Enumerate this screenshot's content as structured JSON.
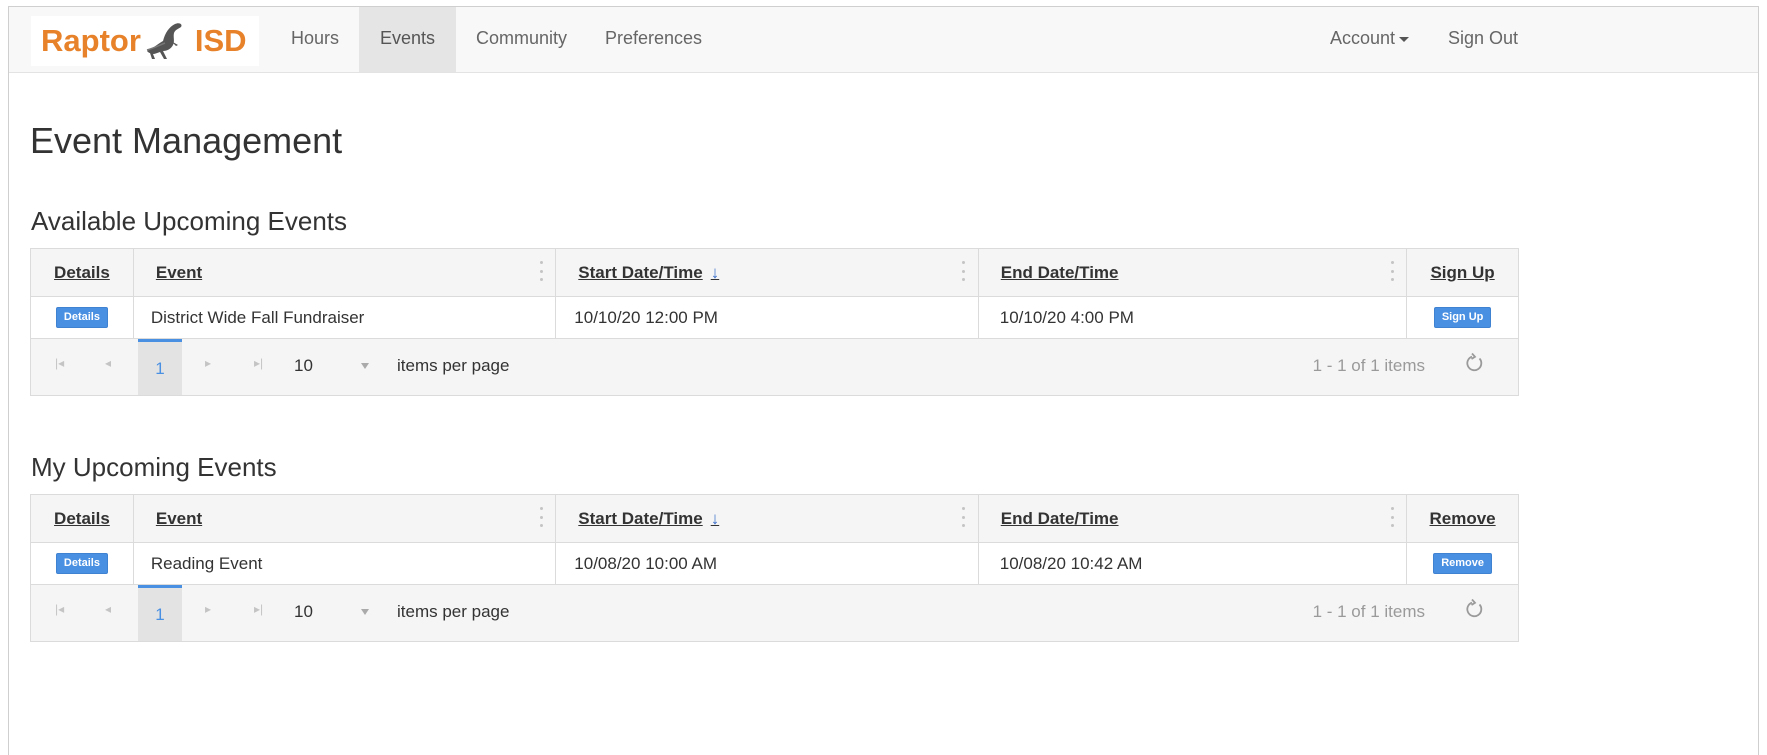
{
  "brand": {
    "left_text": "Raptor",
    "right_text": "ISD",
    "logo_icon": "raptor-dinosaur-icon",
    "color": "#e8822a"
  },
  "nav": {
    "items": [
      {
        "label": "Hours"
      },
      {
        "label": "Events",
        "active": true
      },
      {
        "label": "Community"
      },
      {
        "label": "Preferences"
      }
    ],
    "account_label": "Account",
    "sign_out_label": "Sign Out"
  },
  "page": {
    "title": "Event Management"
  },
  "available": {
    "title": "Available Upcoming Events",
    "columns": {
      "details": "Details",
      "event": "Event",
      "start": "Start Date/Time",
      "end": "End Date/Time",
      "action": "Sign Up"
    },
    "sort_arrow": "↓",
    "rows": [
      {
        "details_btn": "Details",
        "event": "District Wide Fall Fundraiser",
        "start": "10/10/20 12:00 PM",
        "end": "10/10/20 4:00 PM",
        "action_btn": "Sign Up"
      }
    ],
    "pager": {
      "current_page": "1",
      "page_size": "10",
      "page_size_label": "items per page",
      "info": "1 - 1 of 1 items"
    }
  },
  "mine": {
    "title": "My Upcoming Events",
    "columns": {
      "details": "Details",
      "event": "Event",
      "start": "Start Date/Time",
      "end": "End Date/Time",
      "action": "Remove"
    },
    "sort_arrow": "↓",
    "rows": [
      {
        "details_btn": "Details",
        "event": "Reading Event",
        "start": "10/08/20 10:00 AM",
        "end": "10/08/20 10:42 AM",
        "action_btn": "Remove"
      }
    ],
    "pager": {
      "current_page": "1",
      "page_size": "10",
      "page_size_label": "items per page",
      "info": "1 - 1 of 1 items"
    }
  },
  "colors": {
    "accent": "#4a90e2",
    "brand": "#e8822a",
    "nav_active_bg": "#e5e5e5"
  }
}
